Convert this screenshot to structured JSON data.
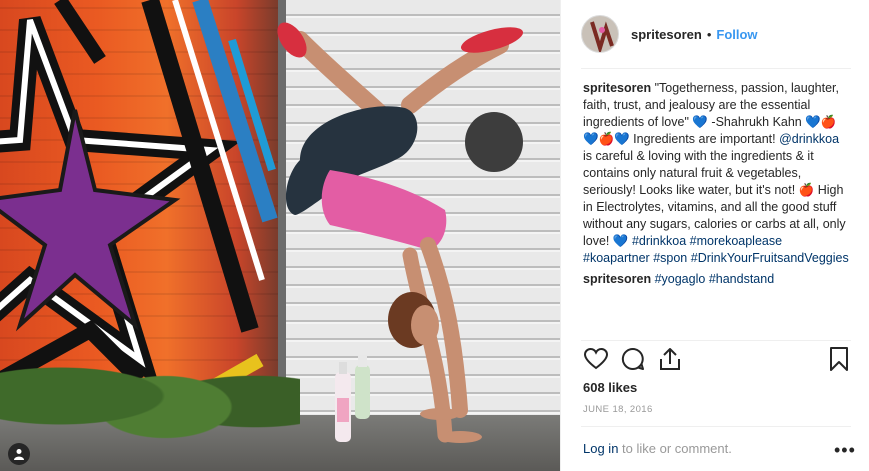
{
  "post": {
    "username": "spritesoren",
    "dot": "•",
    "follow_label": "Follow",
    "caption": {
      "author": "spritesoren",
      "text_1": " \"Togetherness, passion, laughter, faith, trust, and jealousy are the essential ingredients of love\" ",
      "emoji_1": "💙",
      "text_2": " -Shahrukh Kahn ",
      "emoji_2": "💙🍎💙🍎💙",
      "text_3": " Ingredients are important! ",
      "mention": "@drinkkoa",
      "text_4": " is careful & loving with the ingredients & it contains only natural fruit & vegetables, seriously! Looks like water, but it's not! ",
      "emoji_3": "🍎",
      "text_5": " High in Electrolytes, vitamins, and all the good stuff without any sugars, calories or carbs at all, only love! ",
      "emoji_4": "💙",
      "hashtag_1": "#drinkkoa",
      "hashtag_2": "#morekoaplease",
      "hashtag_3": "#koapartner",
      "hashtag_4": "#spon",
      "hashtag_5": "#DrinkYourFruitsandVeggies"
    },
    "comment": {
      "author": "spritesoren",
      "hashtag_1": "#yogaglo",
      "hashtag_2": "#handstand"
    },
    "likes": "608 likes",
    "date": "JUNE 18, 2016",
    "login_link": "Log in",
    "login_rest": " to like or comment.",
    "more_label": "•••",
    "icons": {
      "like": "heart-icon",
      "comment": "comment-bubble-icon",
      "share": "share-icon",
      "save": "bookmark-icon",
      "tags": "user-tag-icon"
    },
    "colors": {
      "link_blue": "#3897f0",
      "hashtag": "#003569",
      "muted": "#999999"
    }
  }
}
